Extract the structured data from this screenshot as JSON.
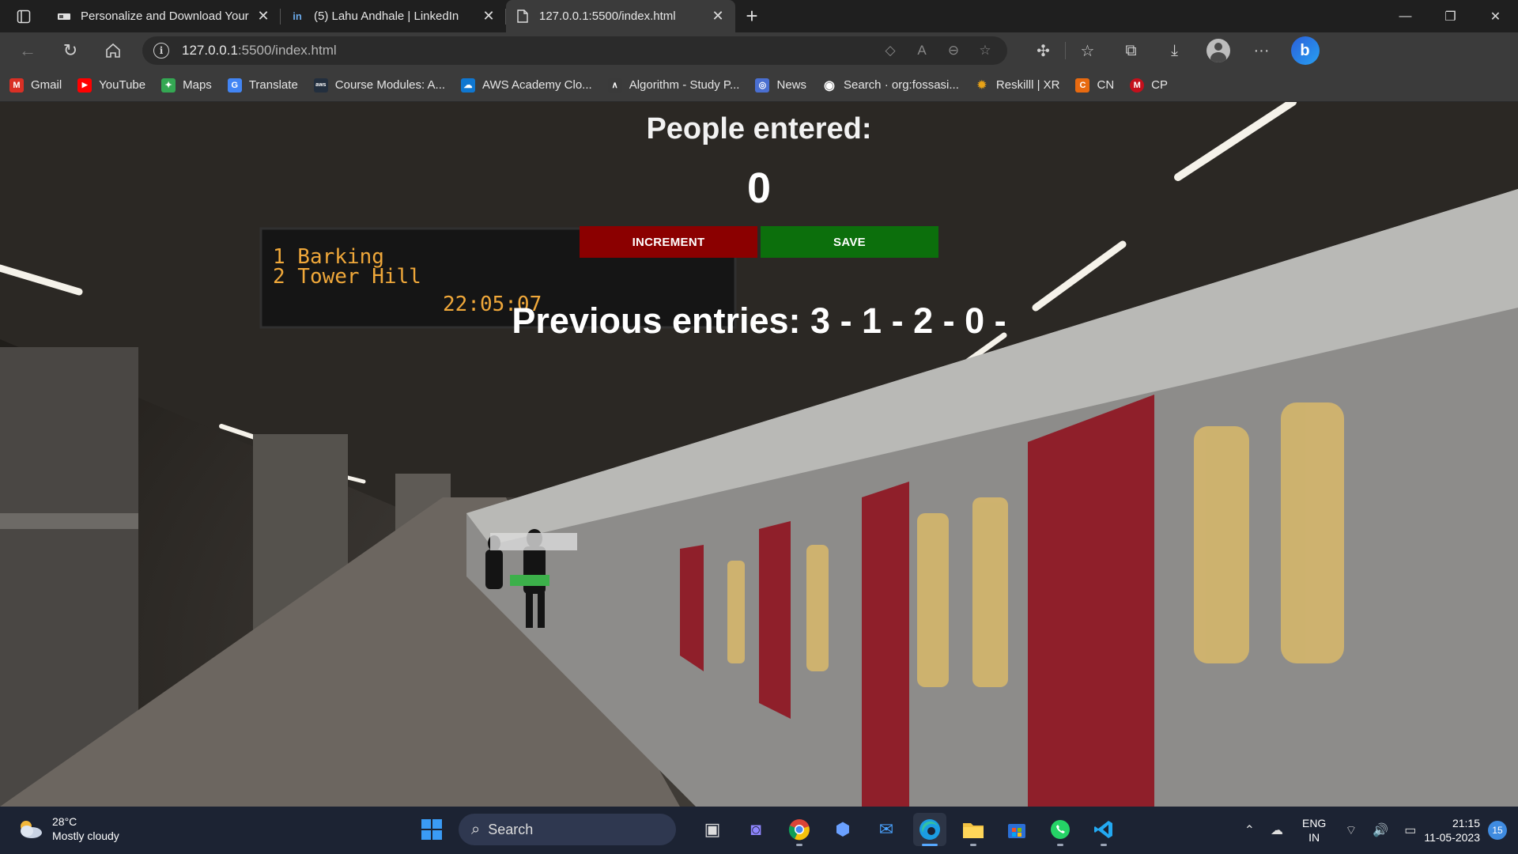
{
  "browser": {
    "tabs": [
      {
        "title": "Personalize and Download Your",
        "icon": "document-icon",
        "active": false
      },
      {
        "title": "(5) Lahu Andhale | LinkedIn",
        "icon": "linkedin-icon",
        "active": false
      },
      {
        "title": "127.0.0.1:5500/index.html",
        "icon": "page-icon",
        "active": true
      }
    ],
    "address": {
      "host": "127.0.0.1",
      "rest": ":5500/index.html"
    },
    "bookmarks": [
      {
        "label": "Gmail",
        "color": "#d93025",
        "glyph": "M"
      },
      {
        "label": "YouTube",
        "color": "#ff0000",
        "glyph": "▶"
      },
      {
        "label": "Maps",
        "color": "#34a853",
        "glyph": "✦"
      },
      {
        "label": "Translate",
        "color": "#4285f4",
        "glyph": "G"
      },
      {
        "label": "Course Modules: A...",
        "color": "#232f3e",
        "glyph": "aws"
      },
      {
        "label": "AWS Academy Clo...",
        "color": "#0f77d1",
        "glyph": "☁"
      },
      {
        "label": "Algorithm - Study P...",
        "color": "#3a3a3a",
        "glyph": "∧"
      },
      {
        "label": "News",
        "color": "#4a6fd1",
        "glyph": "◎"
      },
      {
        "label": "Search · org:fossasi...",
        "color": "#3b3b3b",
        "glyph": "◉"
      },
      {
        "label": "Reskilll | XR",
        "color": "#e8a317",
        "glyph": "✹"
      },
      {
        "label": "CN",
        "color": "#e86a10",
        "glyph": "C"
      },
      {
        "label": "CP",
        "color": "#c4101c",
        "glyph": "M"
      }
    ]
  },
  "page": {
    "heading": "People entered:",
    "count": "0",
    "increment_label": "INCREMENT",
    "save_label": "SAVE",
    "previous_entries": "Previous entries: 3 - 1 - 2 - 0 -"
  },
  "taskbar": {
    "temperature": "28°C",
    "weather": "Mostly cloudy",
    "search_label": "Search",
    "lang_line1": "ENG",
    "lang_line2": "IN",
    "time": "21:15",
    "date": "11-05-2023",
    "notifications": "15"
  },
  "colors": {
    "increment_bg": "#8b0000",
    "save_bg": "#0c6f0c"
  }
}
